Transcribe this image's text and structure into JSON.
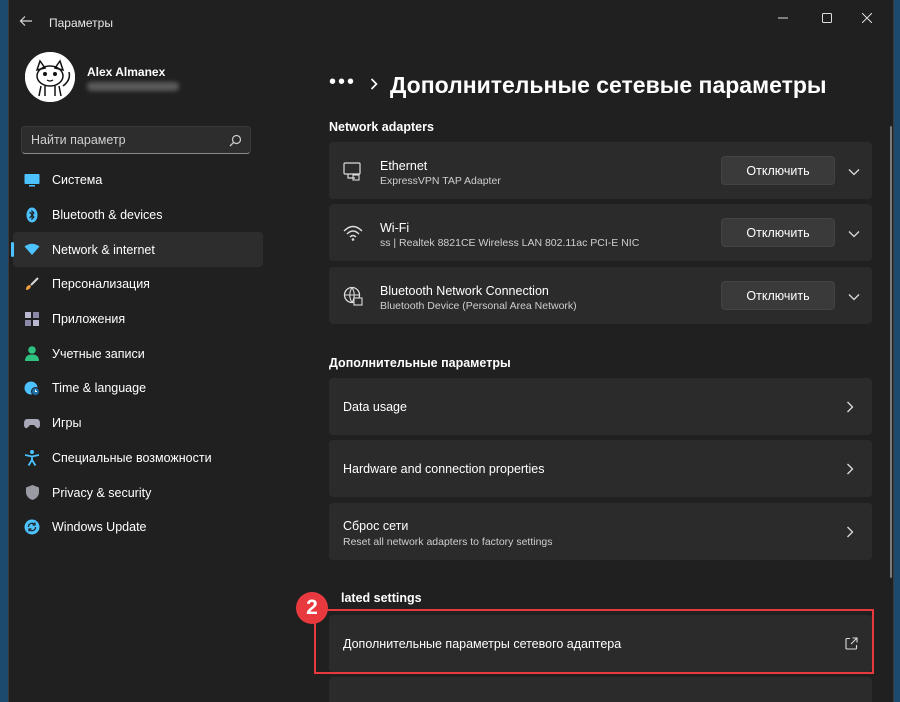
{
  "window": {
    "title": "Параметры"
  },
  "profile": {
    "name": "Alex Almanex"
  },
  "search": {
    "placeholder": "Найти параметр"
  },
  "nav": {
    "items": [
      {
        "label": "Система",
        "icon": "monitor-icon",
        "color": "#4cc2ff"
      },
      {
        "label": "Bluetooth & devices",
        "icon": "bluetooth-icon",
        "color": "#4cc2ff"
      },
      {
        "label": "Network & internet",
        "icon": "wifi-icon",
        "color": "#4cc2ff",
        "active": true
      },
      {
        "label": "Персонализация",
        "icon": "brush-icon",
        "color": "#f0a040"
      },
      {
        "label": "Приложения",
        "icon": "apps-icon",
        "color": "#a0a0c0"
      },
      {
        "label": "Учетные записи",
        "icon": "person-icon",
        "color": "#2ec27e"
      },
      {
        "label": "Time & language",
        "icon": "globe-clock-icon",
        "color": "#4cc2ff"
      },
      {
        "label": "Игры",
        "icon": "gamepad-icon",
        "color": "#a0a0b0"
      },
      {
        "label": "Специальные возможности",
        "icon": "accessibility-icon",
        "color": "#4cc2ff"
      },
      {
        "label": "Privacy & security",
        "icon": "shield-icon",
        "color": "#a0a0a0"
      },
      {
        "label": "Windows Update",
        "icon": "update-icon",
        "color": "#4cc2ff"
      }
    ]
  },
  "main": {
    "breadcrumb_dots": "•••",
    "title": "Дополнительные сетевые параметры",
    "adapters_section": "Network adapters",
    "adapters": [
      {
        "name": "Ethernet",
        "detail": "ExpressVPN TAP Adapter",
        "button": "Отключить",
        "icon": "ethernet-icon"
      },
      {
        "name": "Wi-Fi",
        "detail": "ss | Realtek 8821CE Wireless LAN 802.11ac PCI-E NIC",
        "button": "Отключить",
        "icon": "wifi-icon"
      },
      {
        "name": "Bluetooth Network Connection",
        "detail": "Bluetooth Device (Personal Area Network)",
        "button": "Отключить",
        "icon": "globe-network-icon"
      }
    ],
    "more_section": "Дополнительные параметры",
    "more_items": [
      {
        "title": "Data usage"
      },
      {
        "title": "Hardware and connection properties"
      },
      {
        "title": "Сброс сети",
        "subtitle": "Reset all network adapters to factory settings"
      }
    ],
    "related_section": "lated settings",
    "related_items": [
      {
        "title": "Дополнительные параметры сетевого адаптера"
      }
    ],
    "badge": "2"
  },
  "colors": {
    "accent": "#4cc2ff",
    "highlight": "#e8393f",
    "window_bg": "#202020",
    "card_bg": "#2b2b2b"
  }
}
